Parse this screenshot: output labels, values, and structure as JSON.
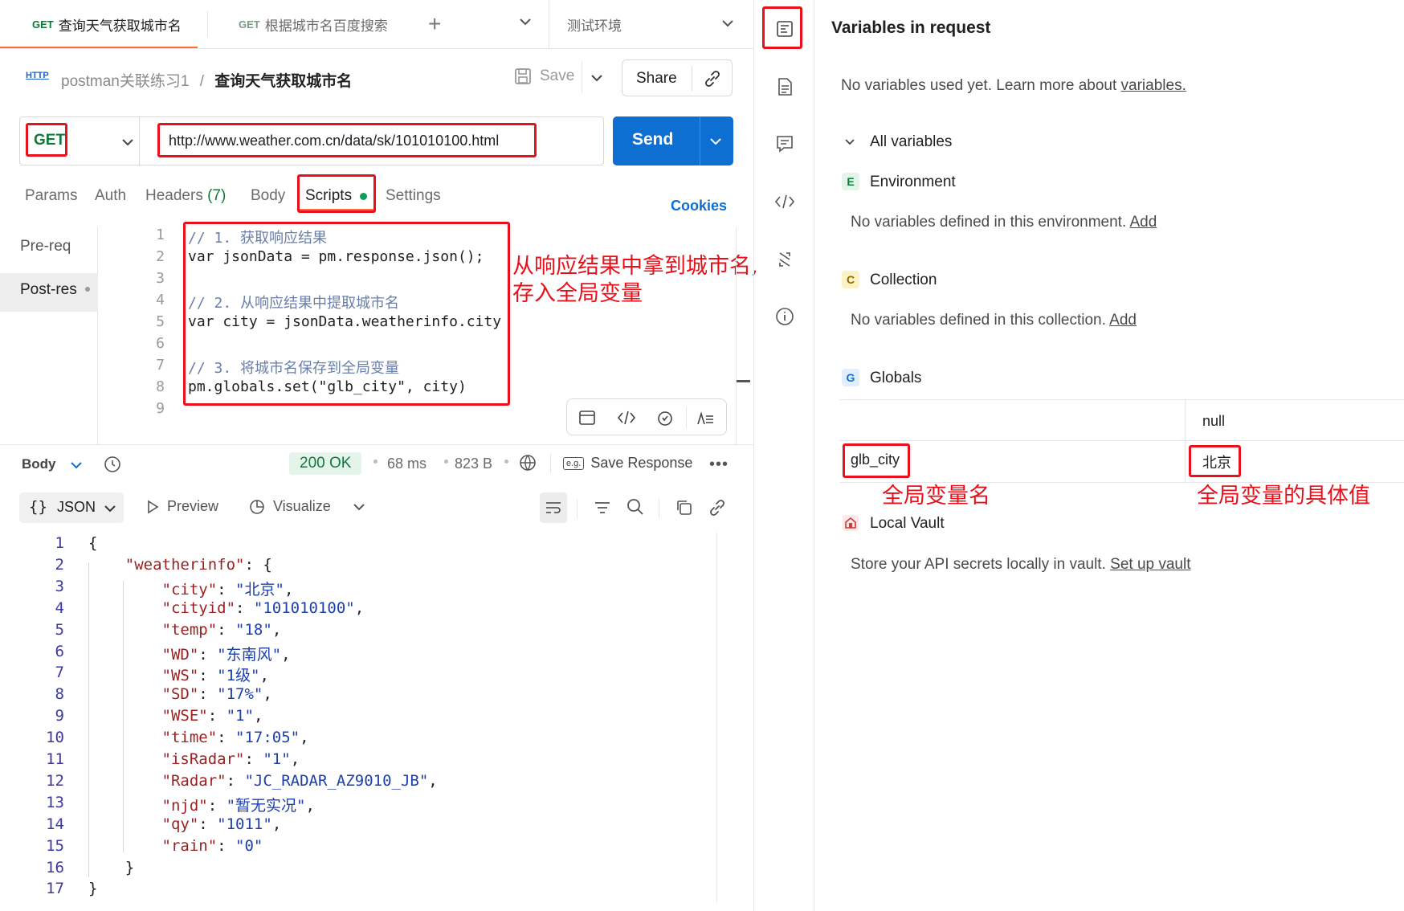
{
  "tabs": [
    {
      "method": "GET",
      "label": "查询天气获取城市名"
    },
    {
      "method": "GET",
      "label": "根据城市名百度搜索"
    }
  ],
  "add_tab": "+",
  "environment": "测试环境",
  "breadcrumb": {
    "badge": "HTTP",
    "collection": "postman关联练习1",
    "separator": "/",
    "request": "查询天气获取城市名"
  },
  "toolbar": {
    "save": "Save",
    "share": "Share"
  },
  "request": {
    "method": "GET",
    "url": "http://www.weather.com.cn/data/sk/101010100.html",
    "send": "Send"
  },
  "subtabs": {
    "params": "Params",
    "auth": "Auth",
    "headers": "Headers",
    "headers_count": "(7)",
    "body": "Body",
    "scripts": "Scripts",
    "settings": "Settings",
    "cookies": "Cookies"
  },
  "script_tabs": {
    "pre": "Pre-req",
    "post": "Post-res"
  },
  "script_lines": [
    {
      "n": "1",
      "text": "// 1. 获取响应结果"
    },
    {
      "n": "2",
      "text": "var jsonData = pm.response.json();"
    },
    {
      "n": "3",
      "text": ""
    },
    {
      "n": "4",
      "text": "// 2. 从响应结果中提取城市名"
    },
    {
      "n": "5",
      "text": "var city = jsonData.weatherinfo.city"
    },
    {
      "n": "6",
      "text": ""
    },
    {
      "n": "7",
      "text": "// 3. 将城市名保存到全局变量"
    },
    {
      "n": "8",
      "text": "pm.globals.set(\"glb_city\", city)"
    },
    {
      "n": "9",
      "text": ""
    }
  ],
  "annotations": {
    "script_note_1": "从响应结果中拿到城市名,",
    "script_note_2": "存入全局变量",
    "var_name_note": "全局变量名",
    "var_value_note": "全局变量的具体值"
  },
  "response": {
    "body_label": "Body",
    "status": "200 OK",
    "time": "68 ms",
    "size": "823 B",
    "save_response": "Save Response",
    "format": "JSON",
    "preview": "Preview",
    "visualize": "Visualize"
  },
  "json_lines": [
    {
      "n": "1",
      "text": "{"
    },
    {
      "n": "2",
      "text": "    \"weatherinfo\": {"
    },
    {
      "n": "3",
      "text": "        \"city\": \"北京\","
    },
    {
      "n": "4",
      "text": "        \"cityid\": \"101010100\","
    },
    {
      "n": "5",
      "text": "        \"temp\": \"18\","
    },
    {
      "n": "6",
      "text": "        \"WD\": \"东南风\","
    },
    {
      "n": "7",
      "text": "        \"WS\": \"1级\","
    },
    {
      "n": "8",
      "text": "        \"SD\": \"17%\","
    },
    {
      "n": "9",
      "text": "        \"WSE\": \"1\","
    },
    {
      "n": "10",
      "text": "        \"time\": \"17:05\","
    },
    {
      "n": "11",
      "text": "        \"isRadar\": \"1\","
    },
    {
      "n": "12",
      "text": "        \"Radar\": \"JC_RADAR_AZ9010_JB\","
    },
    {
      "n": "13",
      "text": "        \"njd\": \"暂无实况\","
    },
    {
      "n": "14",
      "text": "        \"qy\": \"1011\","
    },
    {
      "n": "15",
      "text": "        \"rain\": \"0\""
    },
    {
      "n": "16",
      "text": "    }"
    },
    {
      "n": "17",
      "text": "}"
    }
  ],
  "variables": {
    "title": "Variables in request",
    "none_used": "No variables used yet. Learn more about ",
    "none_used_link": "variables.",
    "all_variables": "All variables",
    "environment": {
      "badge": "E",
      "label": "Environment",
      "empty": "No variables defined in this environment. ",
      "add": "Add"
    },
    "collection": {
      "badge": "C",
      "label": "Collection",
      "empty": "No variables defined in this collection. ",
      "add": "Add"
    },
    "globals": {
      "badge": "G",
      "label": "Globals",
      "header_value": "null",
      "rows": [
        {
          "key": "glb_city",
          "value": "北京"
        }
      ]
    },
    "vault": {
      "label": "Local Vault",
      "text": "Store your API secrets locally in vault. ",
      "link": "Set up vault"
    }
  },
  "colors": {
    "accent": "#0c6fd1",
    "ok": "#0f7b3a",
    "annotation": "#e8101a",
    "tab_underline": "#ff6c37"
  }
}
